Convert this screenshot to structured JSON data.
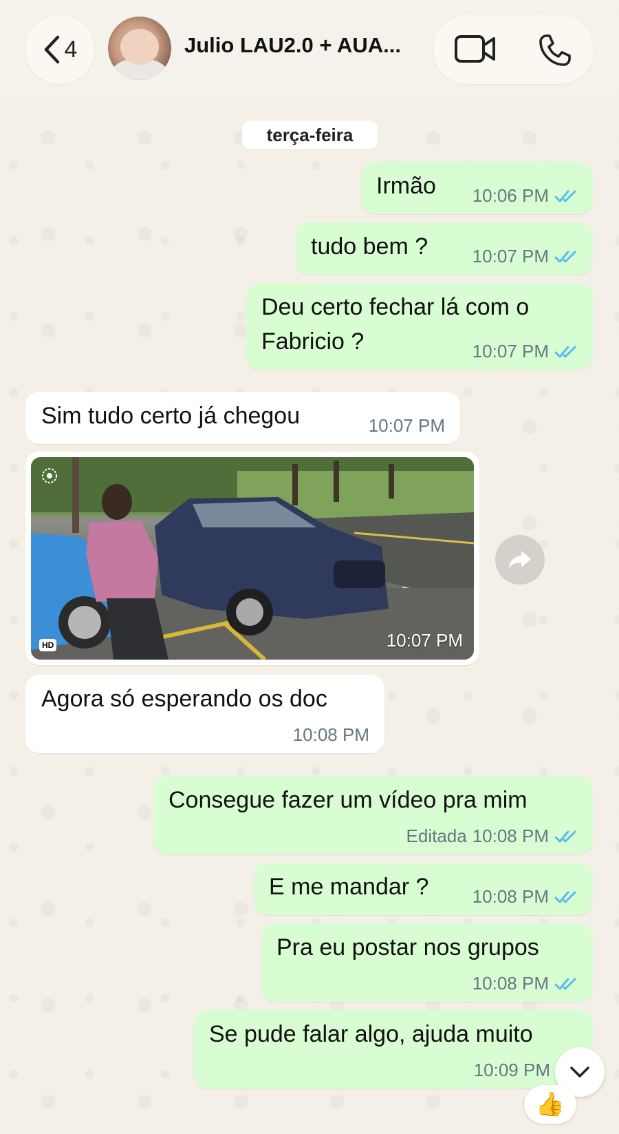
{
  "header": {
    "back_count": "4",
    "title": "Julio LAU2.0 + AUA...",
    "icons": [
      "chevron-left-icon",
      "video-call-icon",
      "phone-icon"
    ]
  },
  "date_separator": "terça-feira",
  "messages": [
    {
      "direction": "out",
      "text": "Irmão",
      "time": "10:06 PM",
      "status": "read"
    },
    {
      "direction": "out",
      "text": "tudo bem ?",
      "time": "10:07 PM",
      "status": "read"
    },
    {
      "direction": "out",
      "text_lines": [
        "Deu certo fechar lá com o",
        "Fabricio ?"
      ],
      "time": "10:07 PM",
      "status": "read"
    },
    {
      "direction": "in",
      "text": "Sim tudo certo já chegou",
      "time": "10:07 PM"
    },
    {
      "direction": "in",
      "type": "image",
      "time": "10:07 PM",
      "badge": "HD"
    },
    {
      "direction": "in",
      "text": "Agora só esperando os doc",
      "time": "10:08 PM"
    },
    {
      "direction": "out",
      "text": "Consegue fazer um vídeo pra mim",
      "edited_label": "Editada",
      "time": "10:08 PM",
      "status": "read"
    },
    {
      "direction": "out",
      "text": "E me mandar ?",
      "time": "10:08 PM",
      "status": "read"
    },
    {
      "direction": "out",
      "text": "Pra eu postar nos grupos",
      "time": "10:08 PM",
      "status": "read"
    },
    {
      "direction": "out",
      "text": "Se pude falar algo, ajuda muito",
      "time": "10:09 PM",
      "status": "read",
      "reaction": "👍"
    }
  ],
  "colors": {
    "outgoing_bubble": "#d9fdd3",
    "incoming_bubble": "#ffffff",
    "read_ticks": "#53bdeb",
    "wallpaper": "#f4f0e8"
  }
}
